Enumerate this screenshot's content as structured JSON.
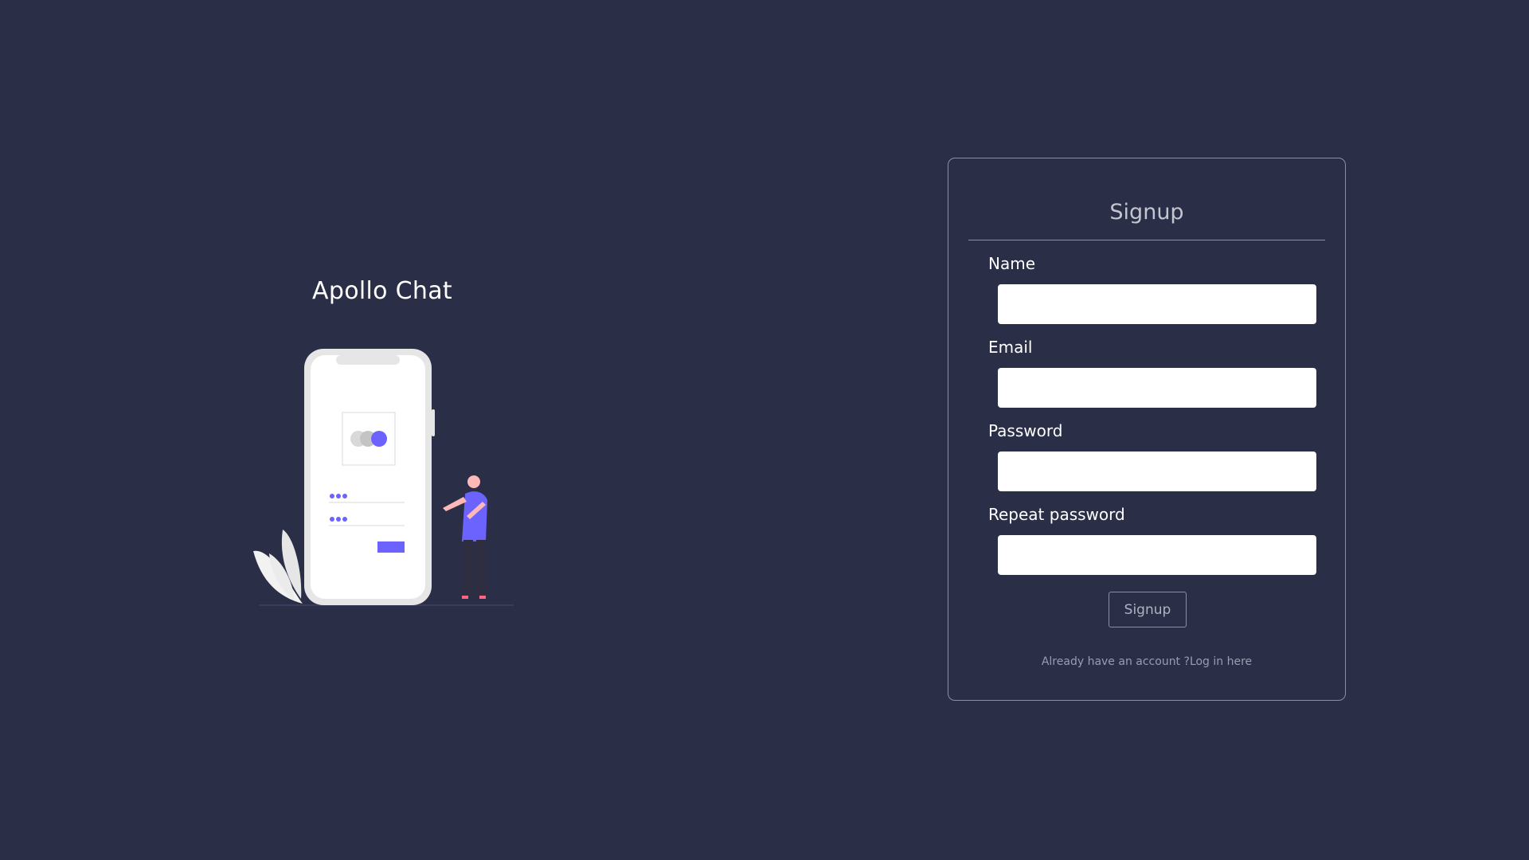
{
  "brand": {
    "title": "Apollo Chat"
  },
  "illustration": {
    "icon": "phone-login-illustration-icon",
    "accent_color": "#6c63ff"
  },
  "signup_form": {
    "title": "Signup",
    "fields": [
      {
        "label": "Name",
        "value": "",
        "type": "text"
      },
      {
        "label": "Email",
        "value": "",
        "type": "email"
      },
      {
        "label": "Password",
        "value": "",
        "type": "password"
      },
      {
        "label": "Repeat password",
        "value": "",
        "type": "password"
      }
    ],
    "submit_label": "Signup",
    "login_prompt": "Already have an account ?",
    "login_link": "Log in here"
  },
  "colors": {
    "background": "#2a2e47",
    "card_border": "#8b8fa3",
    "input_background": "#ffffff"
  }
}
